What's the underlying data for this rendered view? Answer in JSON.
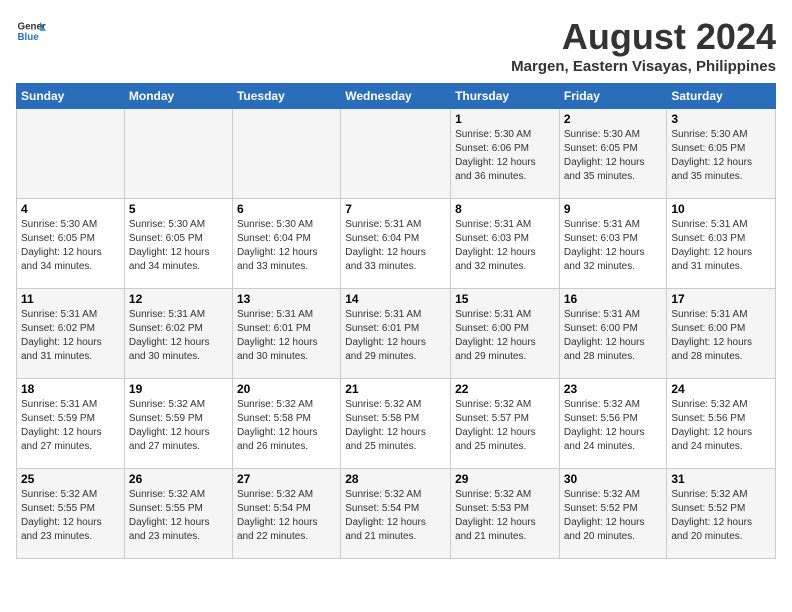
{
  "logo": {
    "general": "General",
    "blue": "Blue"
  },
  "title": "August 2024",
  "subtitle": "Margen, Eastern Visayas, Philippines",
  "days_of_week": [
    "Sunday",
    "Monday",
    "Tuesday",
    "Wednesday",
    "Thursday",
    "Friday",
    "Saturday"
  ],
  "weeks": [
    [
      {
        "day": "",
        "info": ""
      },
      {
        "day": "",
        "info": ""
      },
      {
        "day": "",
        "info": ""
      },
      {
        "day": "",
        "info": ""
      },
      {
        "day": "1",
        "info": "Sunrise: 5:30 AM\nSunset: 6:06 PM\nDaylight: 12 hours\nand 36 minutes."
      },
      {
        "day": "2",
        "info": "Sunrise: 5:30 AM\nSunset: 6:05 PM\nDaylight: 12 hours\nand 35 minutes."
      },
      {
        "day": "3",
        "info": "Sunrise: 5:30 AM\nSunset: 6:05 PM\nDaylight: 12 hours\nand 35 minutes."
      }
    ],
    [
      {
        "day": "4",
        "info": "Sunrise: 5:30 AM\nSunset: 6:05 PM\nDaylight: 12 hours\nand 34 minutes."
      },
      {
        "day": "5",
        "info": "Sunrise: 5:30 AM\nSunset: 6:05 PM\nDaylight: 12 hours\nand 34 minutes."
      },
      {
        "day": "6",
        "info": "Sunrise: 5:30 AM\nSunset: 6:04 PM\nDaylight: 12 hours\nand 33 minutes."
      },
      {
        "day": "7",
        "info": "Sunrise: 5:31 AM\nSunset: 6:04 PM\nDaylight: 12 hours\nand 33 minutes."
      },
      {
        "day": "8",
        "info": "Sunrise: 5:31 AM\nSunset: 6:03 PM\nDaylight: 12 hours\nand 32 minutes."
      },
      {
        "day": "9",
        "info": "Sunrise: 5:31 AM\nSunset: 6:03 PM\nDaylight: 12 hours\nand 32 minutes."
      },
      {
        "day": "10",
        "info": "Sunrise: 5:31 AM\nSunset: 6:03 PM\nDaylight: 12 hours\nand 31 minutes."
      }
    ],
    [
      {
        "day": "11",
        "info": "Sunrise: 5:31 AM\nSunset: 6:02 PM\nDaylight: 12 hours\nand 31 minutes."
      },
      {
        "day": "12",
        "info": "Sunrise: 5:31 AM\nSunset: 6:02 PM\nDaylight: 12 hours\nand 30 minutes."
      },
      {
        "day": "13",
        "info": "Sunrise: 5:31 AM\nSunset: 6:01 PM\nDaylight: 12 hours\nand 30 minutes."
      },
      {
        "day": "14",
        "info": "Sunrise: 5:31 AM\nSunset: 6:01 PM\nDaylight: 12 hours\nand 29 minutes."
      },
      {
        "day": "15",
        "info": "Sunrise: 5:31 AM\nSunset: 6:00 PM\nDaylight: 12 hours\nand 29 minutes."
      },
      {
        "day": "16",
        "info": "Sunrise: 5:31 AM\nSunset: 6:00 PM\nDaylight: 12 hours\nand 28 minutes."
      },
      {
        "day": "17",
        "info": "Sunrise: 5:31 AM\nSunset: 6:00 PM\nDaylight: 12 hours\nand 28 minutes."
      }
    ],
    [
      {
        "day": "18",
        "info": "Sunrise: 5:31 AM\nSunset: 5:59 PM\nDaylight: 12 hours\nand 27 minutes."
      },
      {
        "day": "19",
        "info": "Sunrise: 5:32 AM\nSunset: 5:59 PM\nDaylight: 12 hours\nand 27 minutes."
      },
      {
        "day": "20",
        "info": "Sunrise: 5:32 AM\nSunset: 5:58 PM\nDaylight: 12 hours\nand 26 minutes."
      },
      {
        "day": "21",
        "info": "Sunrise: 5:32 AM\nSunset: 5:58 PM\nDaylight: 12 hours\nand 25 minutes."
      },
      {
        "day": "22",
        "info": "Sunrise: 5:32 AM\nSunset: 5:57 PM\nDaylight: 12 hours\nand 25 minutes."
      },
      {
        "day": "23",
        "info": "Sunrise: 5:32 AM\nSunset: 5:56 PM\nDaylight: 12 hours\nand 24 minutes."
      },
      {
        "day": "24",
        "info": "Sunrise: 5:32 AM\nSunset: 5:56 PM\nDaylight: 12 hours\nand 24 minutes."
      }
    ],
    [
      {
        "day": "25",
        "info": "Sunrise: 5:32 AM\nSunset: 5:55 PM\nDaylight: 12 hours\nand 23 minutes."
      },
      {
        "day": "26",
        "info": "Sunrise: 5:32 AM\nSunset: 5:55 PM\nDaylight: 12 hours\nand 23 minutes."
      },
      {
        "day": "27",
        "info": "Sunrise: 5:32 AM\nSunset: 5:54 PM\nDaylight: 12 hours\nand 22 minutes."
      },
      {
        "day": "28",
        "info": "Sunrise: 5:32 AM\nSunset: 5:54 PM\nDaylight: 12 hours\nand 21 minutes."
      },
      {
        "day": "29",
        "info": "Sunrise: 5:32 AM\nSunset: 5:53 PM\nDaylight: 12 hours\nand 21 minutes."
      },
      {
        "day": "30",
        "info": "Sunrise: 5:32 AM\nSunset: 5:52 PM\nDaylight: 12 hours\nand 20 minutes."
      },
      {
        "day": "31",
        "info": "Sunrise: 5:32 AM\nSunset: 5:52 PM\nDaylight: 12 hours\nand 20 minutes."
      }
    ]
  ]
}
